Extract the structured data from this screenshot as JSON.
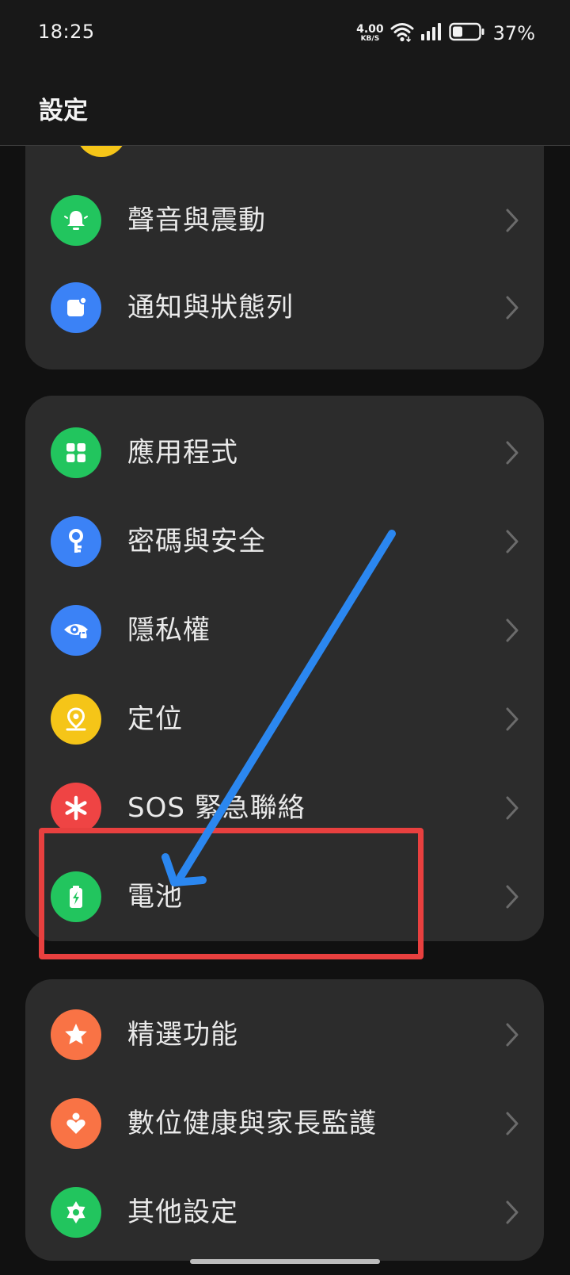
{
  "status_bar": {
    "time": "18:25",
    "net_speed_value": "4.00",
    "net_speed_unit": "KB/S",
    "battery_percent": "37%",
    "battery_level": 0.37
  },
  "header": {
    "title": "設定"
  },
  "sections": [
    {
      "items": [
        {
          "label": "聲音與震動",
          "icon": "bell-icon",
          "color": "#22c55e"
        },
        {
          "label": "通知與狀態列",
          "icon": "notification-icon",
          "color": "#3b82f6"
        }
      ]
    },
    {
      "items": [
        {
          "label": "應用程式",
          "icon": "apps-grid-icon",
          "color": "#22c55e"
        },
        {
          "label": "密碼與安全",
          "icon": "key-icon",
          "color": "#3b82f6"
        },
        {
          "label": "隱私權",
          "icon": "privacy-eye-lock-icon",
          "color": "#3b82f6"
        },
        {
          "label": "定位",
          "icon": "location-pin-icon",
          "color": "#f5c518"
        },
        {
          "label": "SOS 緊急聯絡",
          "icon": "asterisk-icon",
          "color": "#ef4444"
        },
        {
          "label": "電池",
          "icon": "battery-charging-icon",
          "color": "#22c55e"
        }
      ]
    },
    {
      "items": [
        {
          "label": "精選功能",
          "icon": "star-icon",
          "color": "#f97345"
        },
        {
          "label": "數位健康與家長監護",
          "icon": "family-heart-icon",
          "color": "#f97345"
        },
        {
          "label": "其他設定",
          "icon": "gear-icon",
          "color": "#22c55e"
        }
      ]
    }
  ],
  "colors": {
    "annotation_box": "#e8403f",
    "annotation_arrow": "#2b87f0"
  }
}
